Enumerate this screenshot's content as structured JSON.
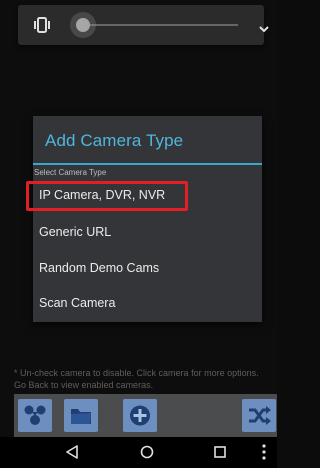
{
  "volume": {
    "icon": "vibrate-icon",
    "level": 0,
    "expand_icon": "chevron-down-icon"
  },
  "dialog": {
    "title": "Add Camera Type",
    "subtitle": "Select Camera Type",
    "options": [
      "IP Camera, DVR, NVR",
      "Generic URL",
      "Random Demo Cams",
      "Scan Camera"
    ],
    "highlighted_index": 0
  },
  "footer": {
    "note": "* Un-check camera to disable. Click camera for more options. Go Back to view enabled cameras."
  },
  "toolbar": {
    "buttons": [
      "grid-icon",
      "folder-icon",
      "add-icon",
      "shuffle-icon"
    ]
  },
  "navbar": {
    "buttons": [
      "back-icon",
      "home-icon",
      "recents-icon",
      "more-icon"
    ]
  },
  "colors": {
    "accent": "#4fb7de",
    "highlight": "#e41f24",
    "dialog_bg": "#333538",
    "toolbar_button": "#6d8fc0"
  }
}
